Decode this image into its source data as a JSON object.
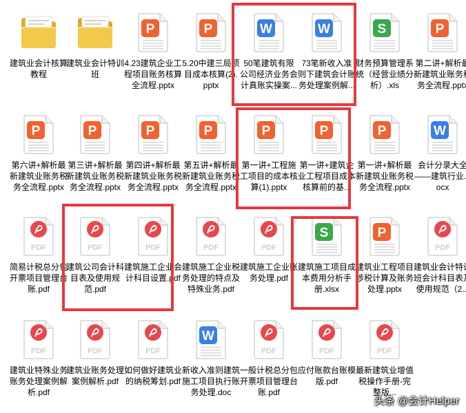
{
  "files": [
    {
      "type": "folder",
      "name": "建筑业会计核算教程"
    },
    {
      "type": "folder",
      "name": "建筑业会计特训班"
    },
    {
      "type": "ppt",
      "name": "4.23建筑企业工程项目账务核算全流程.pptx"
    },
    {
      "type": "ppt",
      "name": "5.20中建三局项目成本核算(2).pptx"
    },
    {
      "type": "word",
      "name": "50笔建筑有限公司经济业务会计真账实操案..."
    },
    {
      "type": "word",
      "name": "73笔新收入准则下建筑会计账务处理案例解..."
    },
    {
      "type": "excel",
      "name": "财务预算管理系统（经营业绩分析）.xls"
    },
    {
      "type": "ppt",
      "name": "第二讲+解析最新建筑业账务税务全流程.pptx"
    },
    {
      "type": "ppt",
      "name": "第六讲+解析最新建筑业账务税务全流程.pptx"
    },
    {
      "type": "ppt",
      "name": "第三讲+解析最新建筑业账务税务全流程.pptx"
    },
    {
      "type": "ppt",
      "name": "第四讲+解析最新建筑业账务税务全流程.pptx"
    },
    {
      "type": "ppt",
      "name": "第五讲+解析最新建筑业账务税务全流程.pptx"
    },
    {
      "type": "ppt",
      "name": "第一讲+工程施工项目的成本核算(1).pptx"
    },
    {
      "type": "ppt",
      "name": "第一讲+建筑企业工程项目成本核算前的基..."
    },
    {
      "type": "ppt",
      "name": "第一讲+解析最新建筑业账务税务全流程.pptx"
    },
    {
      "type": "word",
      "name": "会计分录大全——建筑行业.docx"
    },
    {
      "type": "pdf",
      "name": "简易计税总分包开票项目管理台账.pdf"
    },
    {
      "type": "pdf",
      "name": "建筑公司会计科目表及使用规范.pdf"
    },
    {
      "type": "pdf",
      "name": "建筑施工企业会计科目设置.pdf"
    },
    {
      "type": "pdf",
      "name": "建筑施工企业税务处理的特点及特殊业务.pdf"
    },
    {
      "type": "pdf",
      "name": "建筑施工企业账务处理.pdf"
    },
    {
      "type": "excel",
      "name": "建筑施工项目成本费用分析手册.xlsx"
    },
    {
      "type": "ppt",
      "name": "建筑业工程项目涉税计算及账务处理.pptx"
    },
    {
      "type": "pdf",
      "name": "建筑业会计特训班会计科目表及使用规范（2..."
    },
    {
      "type": "pdf",
      "name": "建筑业特殊业务账务处理案例解析.pdf"
    },
    {
      "type": "pdf",
      "name": "建筑业账务处理案例解析.pdf"
    },
    {
      "type": "pdf",
      "name": "如何做好建筑业的纳税筹划.pdf"
    },
    {
      "type": "word",
      "name": "新收入准则建筑施工项目执行账务处理.doc"
    },
    {
      "type": "pdf",
      "name": "一般计税总分包开票项目管理台账.pdf"
    },
    {
      "type": "pdf",
      "name": "应付账款台账模版.pdf"
    },
    {
      "type": "pdf",
      "name": "最新建筑业增值税操作手册-完整版..."
    }
  ],
  "icon_text": {
    "ppt": "P",
    "word": "W",
    "excel": "S",
    "pdf": "PDF"
  },
  "colors": {
    "ppt": "#f0622f",
    "word": "#3a7ee8",
    "excel": "#3aa84a",
    "pdf": "#e8484c",
    "folder": "#f2c94a",
    "highlight": "#e8383d"
  },
  "watermark": "头条 @会计Helper"
}
